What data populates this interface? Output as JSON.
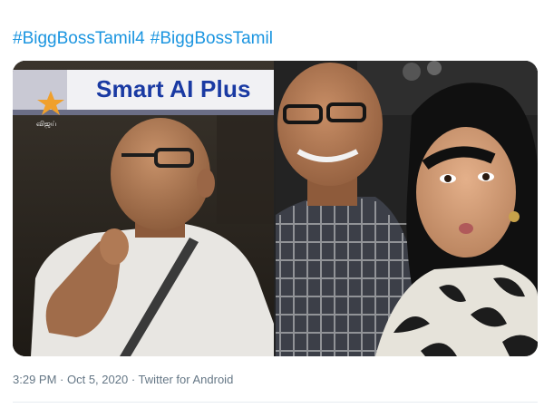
{
  "tweet": {
    "hashtags": [
      "#BiggBossTamil4",
      "#BiggBossTamil"
    ],
    "media": {
      "left_photo": {
        "banner_text": "Smart AI Plus",
        "channel_text": "விஜய்"
      },
      "right_photo": {}
    },
    "meta": {
      "time": "3:29 PM",
      "separator": " · ",
      "date": "Oct 5, 2020",
      "source": "Twitter for Android"
    }
  },
  "colors": {
    "link": "#1b95e0",
    "meta_text": "#657786",
    "divider": "#e6ecf0"
  }
}
